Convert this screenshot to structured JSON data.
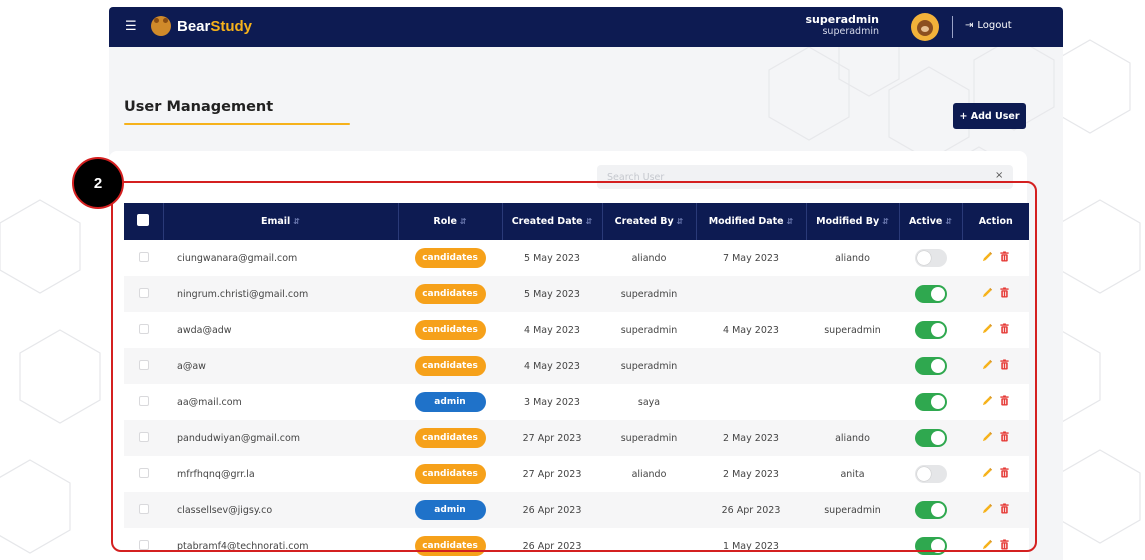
{
  "app": {
    "brand_part1": "Bear",
    "brand_part2": "Study",
    "menu_icon": "☰",
    "user_name": "superadmin",
    "user_role": "superadmin",
    "logout_label": "Logout",
    "logout_icon": "⇥"
  },
  "page": {
    "title": "User Management",
    "add_user_label": "+ Add User",
    "search_placeholder": "Search User",
    "search_clear": "×",
    "step_badge": "2"
  },
  "colors": {
    "navbar": "#0d1b52",
    "accent": "#f6b21b",
    "candidates": "#f6a11a",
    "admin": "#1f72c9",
    "toggle_on": "#2fa84f",
    "highlight": "#d42020"
  },
  "table": {
    "columns": [
      "Email",
      "Role",
      "Created Date",
      "Created By",
      "Modified Date",
      "Modified By",
      "Active",
      "Action"
    ],
    "sortable": [
      true,
      true,
      true,
      true,
      true,
      true,
      true,
      false
    ],
    "rows": [
      {
        "email": "ciungwanara@gmail.com",
        "role": "candidates",
        "created_date": "5 May 2023",
        "created_by": "aliando",
        "modified_date": "7 May 2023",
        "modified_by": "aliando",
        "active": false
      },
      {
        "email": "ningrum.christi@gmail.com",
        "role": "candidates",
        "created_date": "5 May 2023",
        "created_by": "superadmin",
        "modified_date": "",
        "modified_by": "",
        "active": true
      },
      {
        "email": "awda@adw",
        "role": "candidates",
        "created_date": "4 May 2023",
        "created_by": "superadmin",
        "modified_date": "4 May 2023",
        "modified_by": "superadmin",
        "active": true
      },
      {
        "email": "a@aw",
        "role": "candidates",
        "created_date": "4 May 2023",
        "created_by": "superadmin",
        "modified_date": "",
        "modified_by": "",
        "active": true
      },
      {
        "email": "aa@mail.com",
        "role": "admin",
        "created_date": "3 May 2023",
        "created_by": "saya",
        "modified_date": "",
        "modified_by": "",
        "active": true
      },
      {
        "email": "pandudwiyan@gmail.com",
        "role": "candidates",
        "created_date": "27 Apr 2023",
        "created_by": "superadmin",
        "modified_date": "2 May 2023",
        "modified_by": "aliando",
        "active": true
      },
      {
        "email": "mfrfhqnq@grr.la",
        "role": "candidates",
        "created_date": "27 Apr 2023",
        "created_by": "aliando",
        "modified_date": "2 May 2023",
        "modified_by": "anita",
        "active": false
      },
      {
        "email": "classellsev@jigsy.co",
        "role": "admin",
        "created_date": "26 Apr 2023",
        "created_by": "",
        "modified_date": "26 Apr 2023",
        "modified_by": "superadmin",
        "active": true
      },
      {
        "email": "ptabramf4@technorati.com",
        "role": "candidates",
        "created_date": "26 Apr 2023",
        "created_by": "",
        "modified_date": "1 May 2023",
        "modified_by": "",
        "active": true
      }
    ]
  }
}
